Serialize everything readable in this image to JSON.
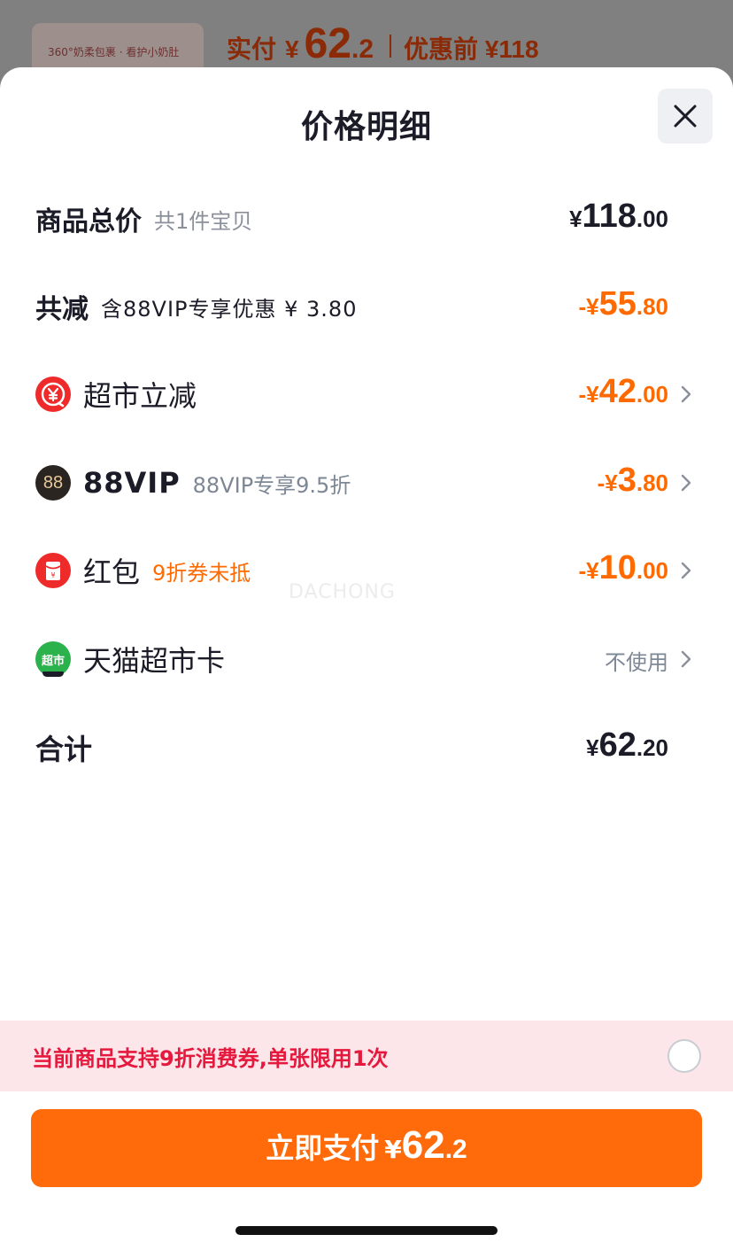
{
  "background": {
    "thumb_text": "360°奶柔包裹 · 看护小奶肚",
    "paid_label": "实付",
    "paid_currency": "¥",
    "paid_int": "62",
    "paid_dec": ".2",
    "orig_label": "优惠前 ¥118"
  },
  "sheet": {
    "title": "价格明细",
    "close_icon": "close-icon"
  },
  "rows": {
    "total": {
      "label": "商品总价",
      "sub": "共1件宝贝",
      "currency": "¥",
      "int": "118",
      "dec": ".00"
    },
    "reduce": {
      "label": "共减",
      "sub": "含88VIP专享优惠 ¥ 3.80",
      "currency": "-¥",
      "int": "55",
      "dec": ".80"
    },
    "supermarket": {
      "icon": "yuan-discount-icon",
      "label": "超市立减",
      "currency": "-¥",
      "int": "42",
      "dec": ".00"
    },
    "vip": {
      "icon": "88vip-badge-icon",
      "icon_text": "88",
      "label": "88VIP",
      "sub": "88VIP专享9.5折",
      "currency": "-¥",
      "int": "3",
      "dec": ".80"
    },
    "redpacket": {
      "icon": "red-packet-icon",
      "label": "红包",
      "sub": "9折券未抵",
      "currency": "-¥",
      "int": "10",
      "dec": ".00"
    },
    "card": {
      "icon": "tmall-supermarket-card-icon",
      "icon_text": "超市",
      "label": "天猫超市卡",
      "value": "不使用"
    },
    "sum": {
      "label": "合计",
      "currency": "¥",
      "int": "62",
      "dec": ".20"
    }
  },
  "watermark": "DACHONG",
  "promo": {
    "text": "当前商品支持9折消费券,单张限用1次",
    "checked": false
  },
  "pay_button": {
    "label": "立即支付",
    "currency": "¥",
    "int": "62",
    "dec": ".2"
  },
  "colors": {
    "accent": "#ff6a0a",
    "discount_text": "#ff6a00",
    "promo_bg": "#fde6ea",
    "promo_text": "#e5183d"
  }
}
